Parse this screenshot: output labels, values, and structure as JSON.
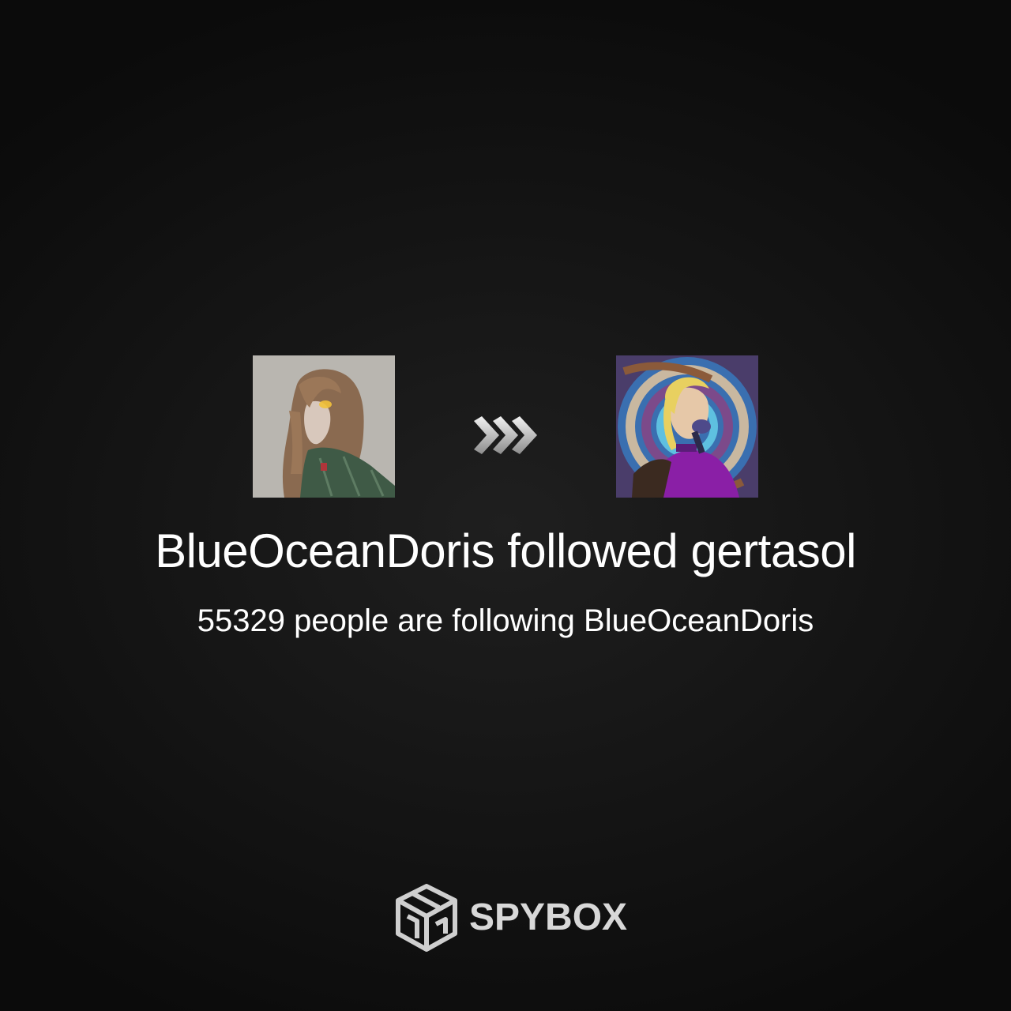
{
  "notification": {
    "follower": "BlueOceanDoris",
    "action_word": "followed",
    "followee": "gertasol",
    "follower_count": "55329",
    "follower_count_text": "people are following",
    "count_subject": "BlueOceanDoris"
  },
  "icons": {
    "follow_arrow": "triple-chevron-right-icon",
    "brand_logo": "isometric-box-logo"
  },
  "brand": {
    "name": "SPYBOX"
  },
  "colors": {
    "background": "#111111",
    "text": "#ffffff",
    "brand_text": "#d8d8d8"
  }
}
